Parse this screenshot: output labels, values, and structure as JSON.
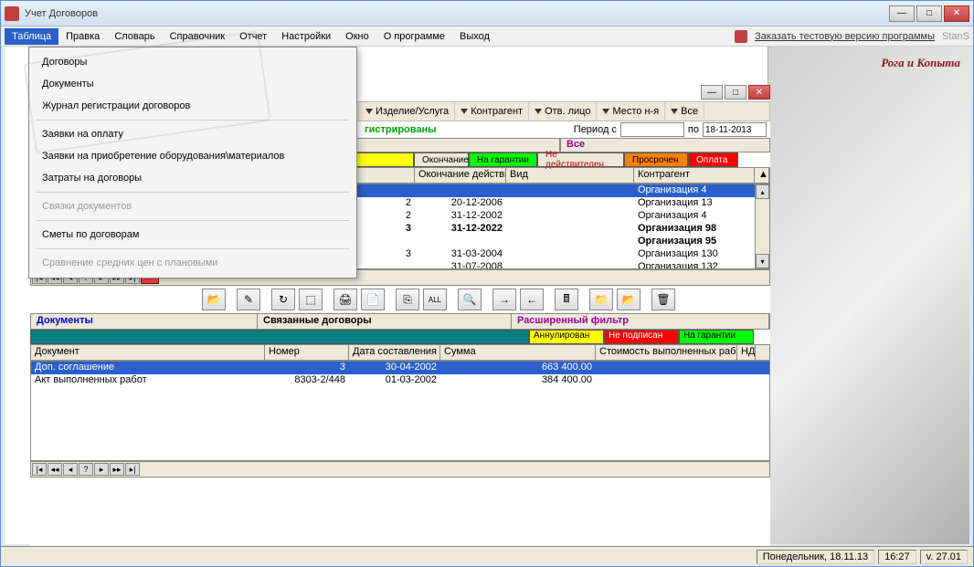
{
  "window": {
    "title": "Учет Договоров"
  },
  "menubar": {
    "items": [
      "Таблица",
      "Правка",
      "Словарь",
      "Справочник",
      "Отчет",
      "Настройки",
      "Окно",
      "О программе",
      "Выход"
    ],
    "order_link": "Заказать тестовую версию программы",
    "stans": "StanS"
  },
  "company": "Рога и Копыта",
  "dropdown": {
    "items": [
      {
        "label": "Договоры",
        "enabled": true
      },
      {
        "label": "Документы",
        "enabled": true
      },
      {
        "label": "Журнал регистрации договоров",
        "enabled": true
      },
      {
        "label": "Заявки на оплату",
        "enabled": true
      },
      {
        "label": "Заявки на приобретение оборудования\\материалов",
        "enabled": true
      },
      {
        "label": "Затраты на договоры",
        "enabled": true
      },
      {
        "label": "Связки документов",
        "enabled": false
      },
      {
        "label": "Сметы по договорам",
        "enabled": true
      },
      {
        "label": "Сравнение средних цен с плановыми",
        "enabled": false
      }
    ]
  },
  "filters": [
    "Изделие/Услуга",
    "Контрагент",
    "Отв. лицо",
    "Место н-я",
    "Все"
  ],
  "subheader": {
    "registered": "гистрированы",
    "period_label": "Период с",
    "po": "по",
    "date_to": "18-11-2013"
  },
  "vse": "Все",
  "statuses": {
    "end": "Окончание",
    "warranty": "На гарантии",
    "invalid": "Не действителен",
    "overdue": "Просрочен",
    "payment": "Оплата"
  },
  "grid": {
    "headers": [
      "Окончание действия",
      "Вид",
      "Контрагент"
    ],
    "rows": [
      {
        "col2": "",
        "end": "",
        "org": "Организация 4",
        "selected": true
      },
      {
        "col2": "2",
        "end": "20-12-2006",
        "org": "Организация 13"
      },
      {
        "col2": "2",
        "end": "31-12-2002",
        "org": "Организация 4"
      },
      {
        "col2": "3",
        "end": "31-12-2022",
        "org": "Организация 98",
        "bold": true
      },
      {
        "col2": "",
        "end": "",
        "org": "Организация 95",
        "bold": true
      },
      {
        "col2": "3",
        "end": "31-03-2004",
        "org": "Организация 130"
      },
      {
        "col2": "",
        "end": "31-07-2008",
        "org": "Организация 132"
      }
    ]
  },
  "sections": {
    "docs": "Документы",
    "linked": "Связанные договоры",
    "filter": "Расширенный фильтр"
  },
  "status2": {
    "annul": "Аннулирован",
    "notsigned": "Не подписан",
    "warranty": "На гарантии"
  },
  "docs_grid": {
    "headers": [
      "Документ",
      "Номер",
      "Дата составления",
      "Сумма",
      "Стоимость выполненных работ",
      "НД"
    ],
    "rows": [
      {
        "doc": "Доп. соглашение",
        "num": "3",
        "date": "30-04-2002",
        "sum": "663 400.00",
        "selected": true
      },
      {
        "doc": "Акт выполненных работ",
        "num": "8303-2/448",
        "date": "01-03-2002",
        "sum": "384 400.00"
      }
    ]
  },
  "statusbar": {
    "date": "Понедельник, 18.11.13",
    "time": "16:27",
    "version": "v. 27.01"
  }
}
